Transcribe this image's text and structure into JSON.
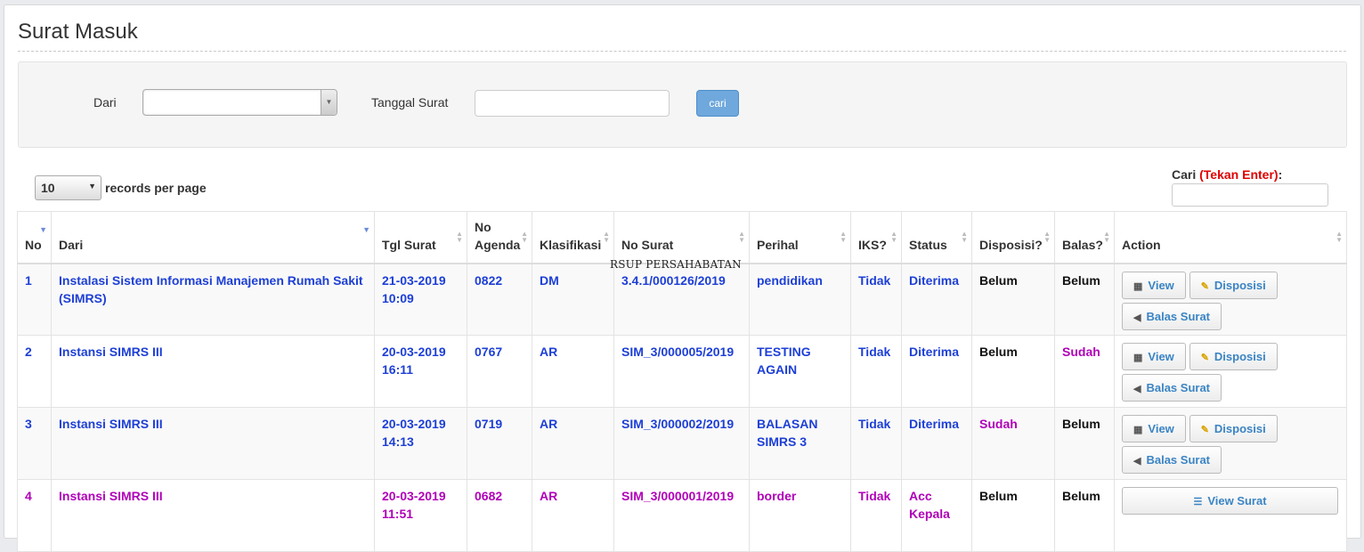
{
  "page": {
    "title": "Surat Masuk"
  },
  "filter": {
    "dari_label": "Dari",
    "dari_value": "",
    "tanggal_label": "Tanggal Surat",
    "tanggal_value": "",
    "button": "cari"
  },
  "length": {
    "value": "10",
    "label": "records per page"
  },
  "search": {
    "label": "Cari",
    "hint": "(Tekan Enter)",
    "colon": ":",
    "value": ""
  },
  "columns": [
    "No",
    "Dari",
    "Tgl Surat",
    "No Agenda",
    "Klasifikasi",
    "No Surat",
    "Perihal",
    "IKS?",
    "Status",
    "Disposisi?",
    "Balas?",
    "Action"
  ],
  "rows": [
    {
      "no": "1",
      "dari": "Instalasi Sistem Informasi Manajemen Rumah Sakit (SIMRS)",
      "tgl": "21-03-2019 10:09",
      "agenda": "0822",
      "klasifikasi": "DM",
      "nosurat": "3.4.1/000126/2019",
      "perihal": "pendidikan",
      "iks": "Tidak",
      "status": "Diterima",
      "disposisi": "Belum",
      "balas": "Belum"
    },
    {
      "no": "2",
      "dari": "Instansi SIMRS III",
      "tgl": "20-03-2019 16:11",
      "agenda": "0767",
      "klasifikasi": "AR",
      "nosurat": "SIM_3/000005/2019",
      "perihal": "TESTING AGAIN",
      "iks": "Tidak",
      "status": "Diterima",
      "disposisi": "Belum",
      "balas": "Sudah"
    },
    {
      "no": "3",
      "dari": "Instansi SIMRS III",
      "tgl": "20-03-2019 14:13",
      "agenda": "0719",
      "klasifikasi": "AR",
      "nosurat": "SIM_3/000002/2019",
      "perihal": "BALASAN SIMRS 3",
      "iks": "Tidak",
      "status": "Diterima",
      "disposisi": "Sudah",
      "balas": "Belum"
    },
    {
      "no": "4",
      "dari": "Instansi SIMRS III",
      "tgl": "20-03-2019 11:51",
      "agenda": "0682",
      "klasifikasi": "AR",
      "nosurat": "SIM_3/000001/2019",
      "perihal": "border",
      "iks": "Tidak",
      "status": "Acc Kepala",
      "disposisi": "Belum",
      "balas": "Belum"
    }
  ],
  "actions": {
    "view": "View",
    "disposisi": "Disposisi",
    "balas": "Balas Surat",
    "view_surat": "View Surat"
  },
  "watermark": "RSUP PERSAHABATAN",
  "colors": {
    "blue": "#1d3fd6",
    "purple": "#b000b8",
    "button_primary": "#6fa8dc"
  }
}
